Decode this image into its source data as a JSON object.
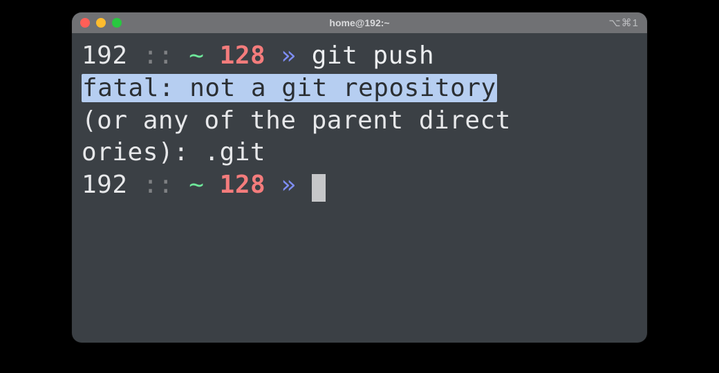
{
  "window": {
    "title": "home@192:~",
    "shortcut_hint": "⌥⌘1"
  },
  "traffic_lights": {
    "close": "#ff5f57",
    "minimize": "#febc2e",
    "zoom": "#28c840"
  },
  "prompt": {
    "host": "192",
    "separator": "::",
    "cwd_symbol": "~",
    "status_code": "128",
    "arrow": "»"
  },
  "session": {
    "command": "git push",
    "error_highlighted": "fatal: not a git repository",
    "error_rest_line1": "(or any of the parent direct",
    "error_rest_line2": "ories): .git"
  }
}
